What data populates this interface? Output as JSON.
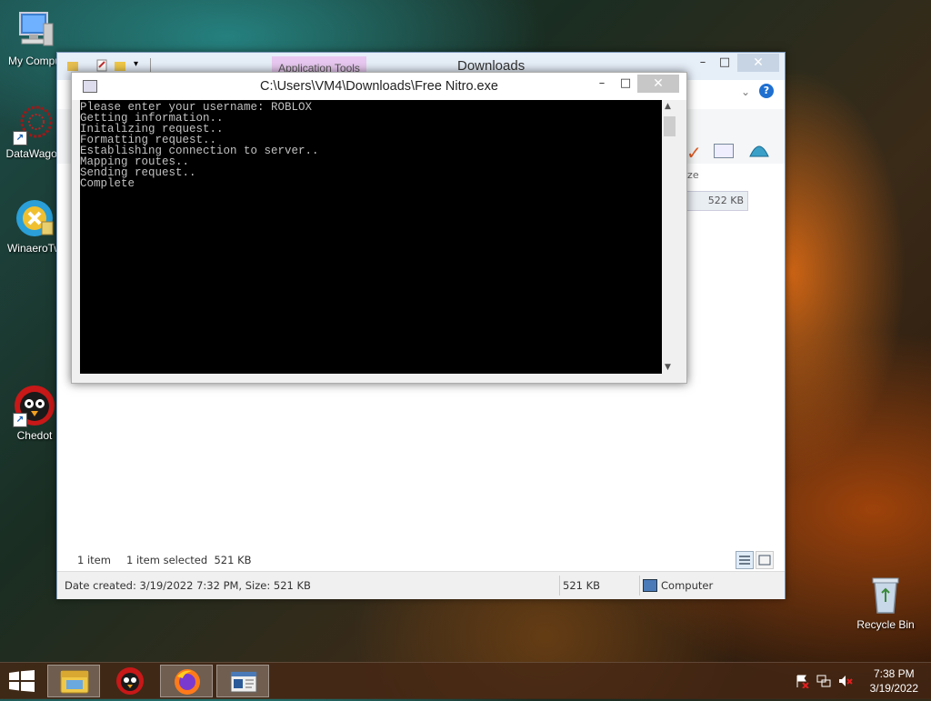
{
  "desktop": {
    "icons": [
      {
        "label": "My Compu"
      },
      {
        "label": "DataWagon"
      },
      {
        "label": "WinaeroTw"
      },
      {
        "label": "Chedot"
      },
      {
        "label": "Recycle Bin"
      }
    ]
  },
  "explorer": {
    "title": "Downloads",
    "app_tools_label": "Application Tools",
    "minimize": "–",
    "maximize": "□",
    "close": "✕",
    "column_size_header": "ize",
    "file_size": "522 KB",
    "status": {
      "item_count": "1 item",
      "selected": "1 item selected  521 KB"
    },
    "details_bar": {
      "info": "Date created: 3/19/2022 7:32 PM, Size: 521 KB",
      "size": "521 KB",
      "location": "Computer"
    }
  },
  "console": {
    "title": "C:\\Users\\VM4\\Downloads\\Free Nitro.exe",
    "minimize": "–",
    "maximize": "□",
    "close": "✕",
    "lines": [
      "Please enter your username: ROBLOX",
      "Getting information..",
      "Initalizing request..",
      "Formatting request..",
      "Establishing connection to server..",
      "Mapping routes..",
      "Sending request..",
      "Complete"
    ]
  },
  "taskbar": {
    "clock_time": "7:38 PM",
    "clock_date": "3/19/2022"
  }
}
